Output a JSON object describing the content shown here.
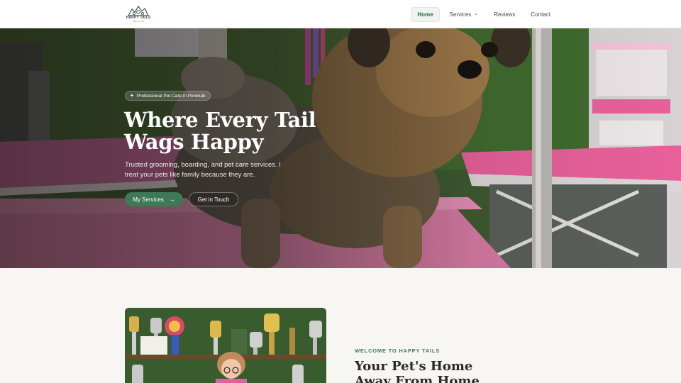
{
  "header": {
    "logo": {
      "name": "HAPPY TAILS",
      "sub": "PENICUIK"
    },
    "nav": [
      {
        "label": "Home",
        "active": true
      },
      {
        "label": "Services",
        "has_dropdown": true
      },
      {
        "label": "Reviews"
      },
      {
        "label": "Contact"
      }
    ]
  },
  "hero": {
    "badge_icon": "sparkle-icon",
    "badge": "Professional Pet Care in Penicuik",
    "title_line1": "Where Every Tail",
    "title_line2": "Wags Happy",
    "subtitle": "Trusted grooming, boarding, and pet care services. I treat your pets like family because they are.",
    "primary_button": "My Services",
    "primary_icon": "arrow-right-icon",
    "secondary_button": "Get in Touch"
  },
  "welcome": {
    "eyebrow": "WELCOME TO HAPPY TAILS",
    "title": "Your Pet's Home Away From Home"
  },
  "colors": {
    "accent": "#3f7a58",
    "accent_bg": "#eef4ef",
    "page_bg": "#f8f6f2",
    "grooming_table_pink": "#e8609a"
  }
}
